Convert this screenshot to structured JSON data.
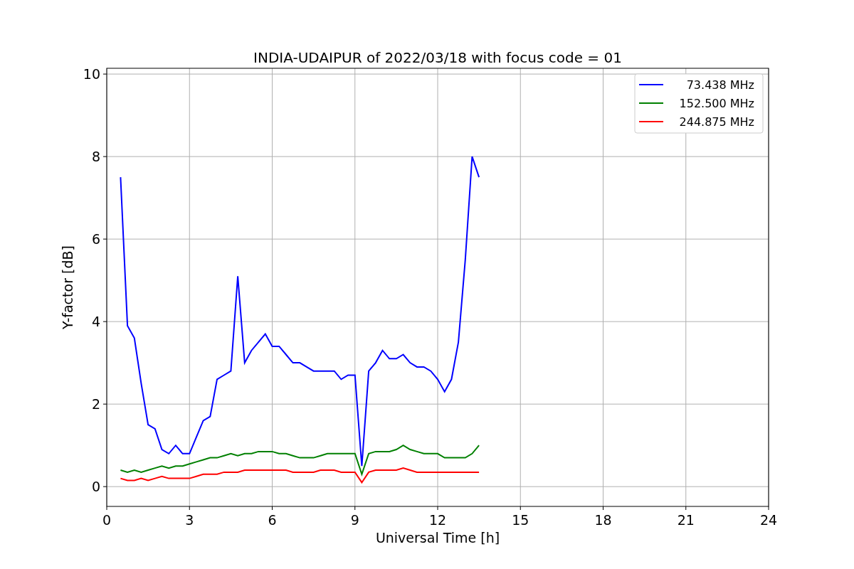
{
  "chart_data": {
    "type": "line",
    "title": "INDIA-UDAIPUR of 2022/03/18 with focus code = 01",
    "xlabel": "Universal Time [h]",
    "ylabel": "Y-factor [dB]",
    "x": [
      0.5,
      0.75,
      1.0,
      1.25,
      1.5,
      1.75,
      2.0,
      2.25,
      2.5,
      2.75,
      3.0,
      3.25,
      3.5,
      3.75,
      4.0,
      4.25,
      4.5,
      4.75,
      5.0,
      5.25,
      5.5,
      5.75,
      6.0,
      6.25,
      6.5,
      6.75,
      7.0,
      7.25,
      7.5,
      7.75,
      8.0,
      8.25,
      8.5,
      8.75,
      9.0,
      9.25,
      9.5,
      9.75,
      10.0,
      10.25,
      10.5,
      10.75,
      11.0,
      11.25,
      11.5,
      11.75,
      12.0,
      12.25,
      12.5,
      12.75,
      13.0,
      13.25,
      13.5
    ],
    "series": [
      {
        "name": "73.438 MHz",
        "color": "#0000ff",
        "values": [
          7.5,
          3.9,
          3.6,
          2.5,
          1.5,
          1.4,
          0.9,
          0.8,
          1.0,
          0.8,
          0.8,
          1.2,
          1.6,
          1.7,
          2.6,
          2.7,
          2.8,
          5.1,
          3.0,
          3.3,
          3.5,
          3.7,
          3.4,
          3.4,
          3.2,
          3.0,
          3.0,
          2.9,
          2.8,
          2.8,
          2.8,
          2.8,
          2.6,
          2.7,
          2.7,
          0.5,
          2.8,
          3.0,
          3.3,
          3.1,
          3.1,
          3.2,
          3.0,
          2.9,
          2.9,
          2.8,
          2.6,
          2.3,
          2.6,
          3.5,
          5.5,
          8.0,
          7.5
        ]
      },
      {
        "name": "152.500 MHz",
        "color": "#008000",
        "values": [
          0.4,
          0.35,
          0.4,
          0.35,
          0.4,
          0.45,
          0.5,
          0.45,
          0.5,
          0.5,
          0.55,
          0.6,
          0.65,
          0.7,
          0.7,
          0.75,
          0.8,
          0.75,
          0.8,
          0.8,
          0.85,
          0.85,
          0.85,
          0.8,
          0.8,
          0.75,
          0.7,
          0.7,
          0.7,
          0.75,
          0.8,
          0.8,
          0.8,
          0.8,
          0.8,
          0.3,
          0.8,
          0.85,
          0.85,
          0.85,
          0.9,
          1.0,
          0.9,
          0.85,
          0.8,
          0.8,
          0.8,
          0.7,
          0.7,
          0.7,
          0.7,
          0.8,
          1.0
        ]
      },
      {
        "name": "244.875 MHz",
        "color": "#ff0000",
        "values": [
          0.2,
          0.15,
          0.15,
          0.2,
          0.15,
          0.2,
          0.25,
          0.2,
          0.2,
          0.2,
          0.2,
          0.25,
          0.3,
          0.3,
          0.3,
          0.35,
          0.35,
          0.35,
          0.4,
          0.4,
          0.4,
          0.4,
          0.4,
          0.4,
          0.4,
          0.35,
          0.35,
          0.35,
          0.35,
          0.4,
          0.4,
          0.4,
          0.35,
          0.35,
          0.35,
          0.1,
          0.35,
          0.4,
          0.4,
          0.4,
          0.4,
          0.45,
          0.4,
          0.35,
          0.35,
          0.35,
          0.35,
          0.35,
          0.35,
          0.35,
          0.35,
          0.35,
          0.35
        ]
      }
    ],
    "xlim": [
      0,
      24
    ],
    "ylim": [
      -0.48,
      10.14
    ],
    "xticks": [
      0,
      3,
      6,
      9,
      12,
      15,
      18,
      21,
      24
    ],
    "yticks": [
      0,
      2,
      4,
      6,
      8,
      10
    ],
    "grid": true,
    "legend": true
  }
}
